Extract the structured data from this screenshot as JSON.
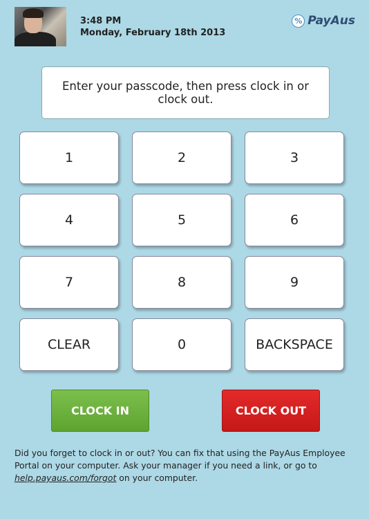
{
  "header": {
    "time": "3:48 PM",
    "date": "Monday, February 18th 2013",
    "brand_name": "PayAus",
    "brand_icon": "percent-logo-icon",
    "brand_color": "#2e4d73"
  },
  "prompt": "Enter your passcode, then press clock in or clock out.",
  "keypad": {
    "k1": "1",
    "k2": "2",
    "k3": "3",
    "k4": "4",
    "k5": "5",
    "k6": "6",
    "k7": "7",
    "k8": "8",
    "k9": "9",
    "clear": "CLEAR",
    "k0": "0",
    "backspace": "BACKSPACE"
  },
  "actions": {
    "clock_in": "CLOCK IN",
    "clock_in_color": "#6ab13c",
    "clock_out": "CLOCK OUT",
    "clock_out_color": "#d42020"
  },
  "help": {
    "text_before": "Did you forget to clock in or out? You can fix that using the PayAus Employee Portal on your computer. Ask your manager if you need a link, or go to ",
    "link": "help.payaus.com/forgot",
    "text_after": " on your computer."
  },
  "colors": {
    "background": "#add8e6"
  }
}
